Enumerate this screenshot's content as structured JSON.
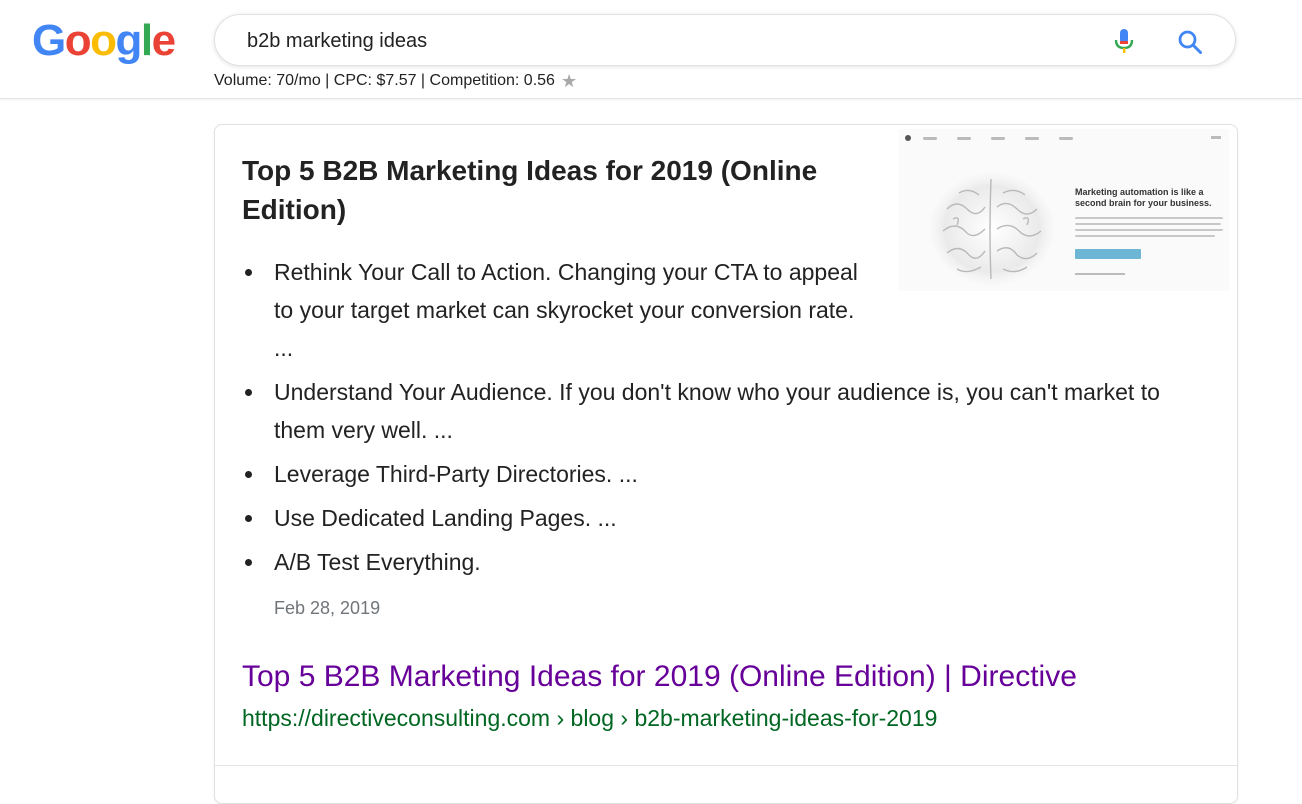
{
  "logo": {
    "letters": [
      {
        "char": "G",
        "color": "#4285F4"
      },
      {
        "char": "o",
        "color": "#EA4335"
      },
      {
        "char": "o",
        "color": "#FBBC05"
      },
      {
        "char": "g",
        "color": "#4285F4"
      },
      {
        "char": "l",
        "color": "#34A853"
      },
      {
        "char": "e",
        "color": "#EA4335"
      }
    ]
  },
  "search": {
    "query": "b2b marketing ideas",
    "mic_icon": "microphone-icon",
    "search_icon": "magnifier-icon"
  },
  "keyword_stats": {
    "text": "Volume: 70/mo | CPC: $7.57 | Competition: 0.56",
    "star_icon": "star-icon"
  },
  "featured_snippet": {
    "title": "Top 5 B2B Marketing Ideas for 2019 (Online Edition)",
    "thumbnail": {
      "headline": "Marketing automation is like a second brain for your business."
    },
    "bullets": [
      "Rethink Your Call to Action. Changing your CTA to appeal to your target market can skyrocket your conversion rate. ...",
      "Understand Your Audience. If you don't know who your audience is, you can't market to them very well. ...",
      "Leverage Third-Party Directories. ...",
      "Use Dedicated Landing Pages. ...",
      "A/B Test Everything."
    ],
    "date": "Feb 28, 2019",
    "result_title": "Top 5 B2B Marketing Ideas for 2019 (Online Edition) | Directive",
    "result_url": "https://directiveconsulting.com › blog › b2b-marketing-ideas-for-2019"
  },
  "colors": {
    "visited_link": "#660099",
    "url_green": "#006621",
    "date_gray": "#70757a"
  }
}
